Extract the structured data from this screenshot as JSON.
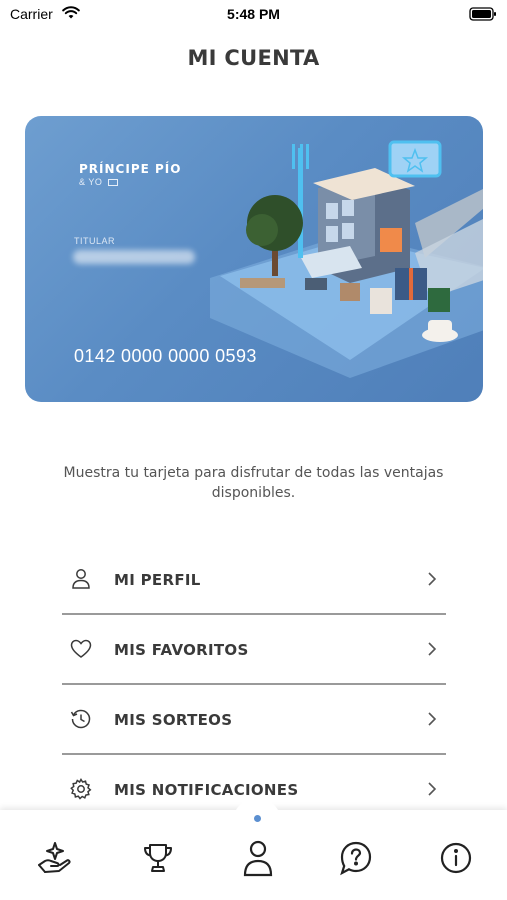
{
  "status_bar": {
    "carrier": "Carrier",
    "time": "5:48 PM"
  },
  "header": {
    "title": "MI CUENTA"
  },
  "card": {
    "brand": "PRÍNCIPE PÍO",
    "brand_sub": "& YO",
    "holder_label": "TITULAR",
    "number": "0142 0000 0000 0593",
    "background_color": "#5a8cc4"
  },
  "helper_text": "Muestra tu tarjeta para disfrutar de todas las ventajas disponibles.",
  "menu": {
    "items": [
      {
        "label": "MI PERFIL",
        "icon": "user-icon"
      },
      {
        "label": "MIS FAVORITOS",
        "icon": "heart-icon"
      },
      {
        "label": "MIS SORTEOS",
        "icon": "history-icon"
      },
      {
        "label": "MIS NOTIFICACIONES",
        "icon": "gear-icon"
      }
    ]
  },
  "tab_bar": {
    "tabs": [
      {
        "icon": "hand-sparkle-icon"
      },
      {
        "icon": "trophy-icon"
      },
      {
        "icon": "user-icon",
        "active": true
      },
      {
        "icon": "help-bubble-icon"
      },
      {
        "icon": "info-icon"
      }
    ],
    "active_indicator_color": "#5b8fd0"
  }
}
